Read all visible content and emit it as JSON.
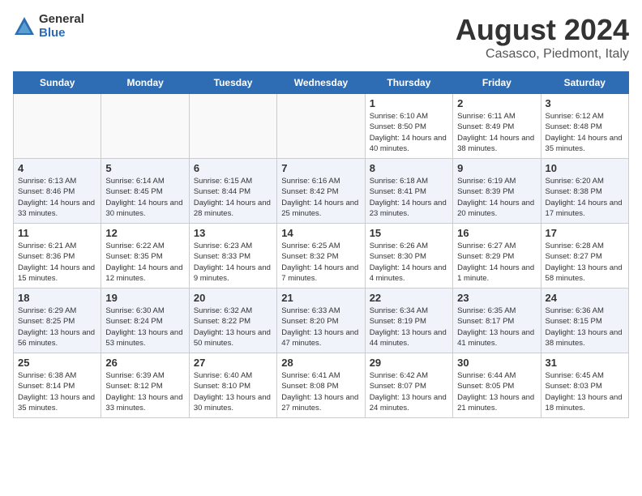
{
  "logo": {
    "general": "General",
    "blue": "Blue"
  },
  "title": "August 2024",
  "subtitle": "Casasco, Piedmont, Italy",
  "days_of_week": [
    "Sunday",
    "Monday",
    "Tuesday",
    "Wednesday",
    "Thursday",
    "Friday",
    "Saturday"
  ],
  "weeks": [
    [
      {
        "day": "",
        "info": ""
      },
      {
        "day": "",
        "info": ""
      },
      {
        "day": "",
        "info": ""
      },
      {
        "day": "",
        "info": ""
      },
      {
        "day": "1",
        "info": "Sunrise: 6:10 AM\nSunset: 8:50 PM\nDaylight: 14 hours and 40 minutes."
      },
      {
        "day": "2",
        "info": "Sunrise: 6:11 AM\nSunset: 8:49 PM\nDaylight: 14 hours and 38 minutes."
      },
      {
        "day": "3",
        "info": "Sunrise: 6:12 AM\nSunset: 8:48 PM\nDaylight: 14 hours and 35 minutes."
      }
    ],
    [
      {
        "day": "4",
        "info": "Sunrise: 6:13 AM\nSunset: 8:46 PM\nDaylight: 14 hours and 33 minutes."
      },
      {
        "day": "5",
        "info": "Sunrise: 6:14 AM\nSunset: 8:45 PM\nDaylight: 14 hours and 30 minutes."
      },
      {
        "day": "6",
        "info": "Sunrise: 6:15 AM\nSunset: 8:44 PM\nDaylight: 14 hours and 28 minutes."
      },
      {
        "day": "7",
        "info": "Sunrise: 6:16 AM\nSunset: 8:42 PM\nDaylight: 14 hours and 25 minutes."
      },
      {
        "day": "8",
        "info": "Sunrise: 6:18 AM\nSunset: 8:41 PM\nDaylight: 14 hours and 23 minutes."
      },
      {
        "day": "9",
        "info": "Sunrise: 6:19 AM\nSunset: 8:39 PM\nDaylight: 14 hours and 20 minutes."
      },
      {
        "day": "10",
        "info": "Sunrise: 6:20 AM\nSunset: 8:38 PM\nDaylight: 14 hours and 17 minutes."
      }
    ],
    [
      {
        "day": "11",
        "info": "Sunrise: 6:21 AM\nSunset: 8:36 PM\nDaylight: 14 hours and 15 minutes."
      },
      {
        "day": "12",
        "info": "Sunrise: 6:22 AM\nSunset: 8:35 PM\nDaylight: 14 hours and 12 minutes."
      },
      {
        "day": "13",
        "info": "Sunrise: 6:23 AM\nSunset: 8:33 PM\nDaylight: 14 hours and 9 minutes."
      },
      {
        "day": "14",
        "info": "Sunrise: 6:25 AM\nSunset: 8:32 PM\nDaylight: 14 hours and 7 minutes."
      },
      {
        "day": "15",
        "info": "Sunrise: 6:26 AM\nSunset: 8:30 PM\nDaylight: 14 hours and 4 minutes."
      },
      {
        "day": "16",
        "info": "Sunrise: 6:27 AM\nSunset: 8:29 PM\nDaylight: 14 hours and 1 minute."
      },
      {
        "day": "17",
        "info": "Sunrise: 6:28 AM\nSunset: 8:27 PM\nDaylight: 13 hours and 58 minutes."
      }
    ],
    [
      {
        "day": "18",
        "info": "Sunrise: 6:29 AM\nSunset: 8:25 PM\nDaylight: 13 hours and 56 minutes."
      },
      {
        "day": "19",
        "info": "Sunrise: 6:30 AM\nSunset: 8:24 PM\nDaylight: 13 hours and 53 minutes."
      },
      {
        "day": "20",
        "info": "Sunrise: 6:32 AM\nSunset: 8:22 PM\nDaylight: 13 hours and 50 minutes."
      },
      {
        "day": "21",
        "info": "Sunrise: 6:33 AM\nSunset: 8:20 PM\nDaylight: 13 hours and 47 minutes."
      },
      {
        "day": "22",
        "info": "Sunrise: 6:34 AM\nSunset: 8:19 PM\nDaylight: 13 hours and 44 minutes."
      },
      {
        "day": "23",
        "info": "Sunrise: 6:35 AM\nSunset: 8:17 PM\nDaylight: 13 hours and 41 minutes."
      },
      {
        "day": "24",
        "info": "Sunrise: 6:36 AM\nSunset: 8:15 PM\nDaylight: 13 hours and 38 minutes."
      }
    ],
    [
      {
        "day": "25",
        "info": "Sunrise: 6:38 AM\nSunset: 8:14 PM\nDaylight: 13 hours and 35 minutes."
      },
      {
        "day": "26",
        "info": "Sunrise: 6:39 AM\nSunset: 8:12 PM\nDaylight: 13 hours and 33 minutes."
      },
      {
        "day": "27",
        "info": "Sunrise: 6:40 AM\nSunset: 8:10 PM\nDaylight: 13 hours and 30 minutes."
      },
      {
        "day": "28",
        "info": "Sunrise: 6:41 AM\nSunset: 8:08 PM\nDaylight: 13 hours and 27 minutes."
      },
      {
        "day": "29",
        "info": "Sunrise: 6:42 AM\nSunset: 8:07 PM\nDaylight: 13 hours and 24 minutes."
      },
      {
        "day": "30",
        "info": "Sunrise: 6:44 AM\nSunset: 8:05 PM\nDaylight: 13 hours and 21 minutes."
      },
      {
        "day": "31",
        "info": "Sunrise: 6:45 AM\nSunset: 8:03 PM\nDaylight: 13 hours and 18 minutes."
      }
    ]
  ]
}
